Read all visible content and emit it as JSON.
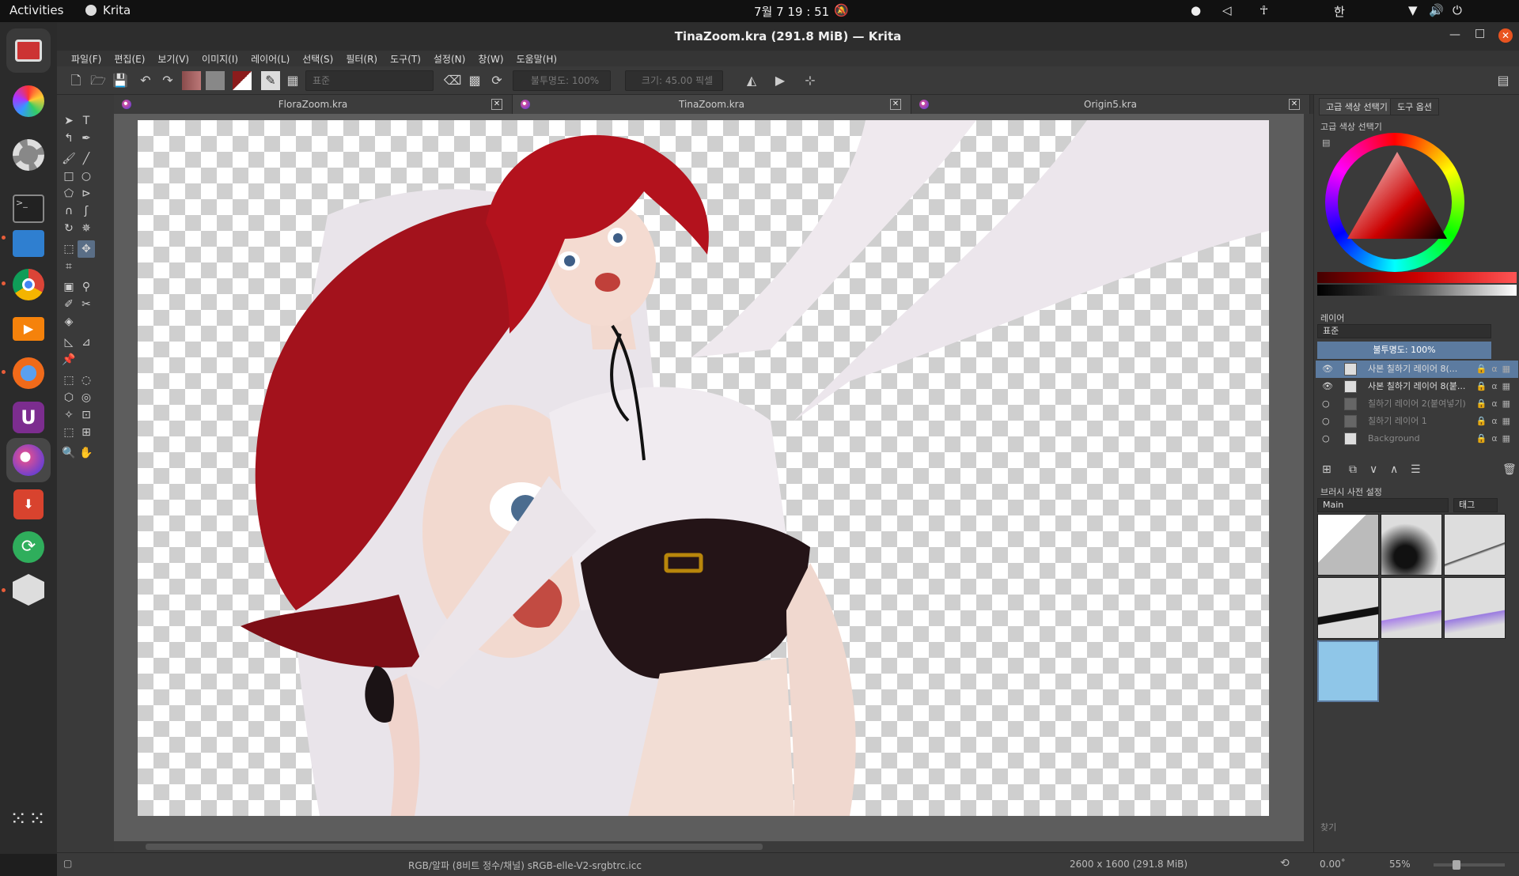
{
  "topbar": {
    "activities": "Activities",
    "app_name": "Krita",
    "clock": "7월 7  19 : 51",
    "input_method": "한"
  },
  "window": {
    "title": "TinaZoom.kra (291.8 MiB) — Krita"
  },
  "menu": [
    "파일(F)",
    "편집(E)",
    "보기(V)",
    "이미지(I)",
    "레이어(L)",
    "선택(S)",
    "필터(R)",
    "도구(T)",
    "설정(N)",
    "창(W)",
    "도움말(H)"
  ],
  "toolbar": {
    "blend_mode": "표준",
    "opacity": "불투명도: 100%",
    "size": "크기: 45.00 픽셀"
  },
  "tabs": [
    {
      "label": "FloraZoom.kra"
    },
    {
      "label": "TinaZoom.kra"
    },
    {
      "label": "Origin5.kra"
    }
  ],
  "docker": {
    "tab_color": "고급 색상 선택기",
    "tab_tool": "도구 옵션",
    "color_title": "고급 색상 선택기",
    "layers_title": "레이어",
    "layer_blend": "표준",
    "layer_opacity": "불투명도:  100%",
    "layers": [
      {
        "name": "사본 칠하기 레이어 8(..."
      },
      {
        "name": "사본 칠하기 레이어 8(붙..."
      },
      {
        "name": "칠하기 레이어 2(붙여넣기)"
      },
      {
        "name": "칠하기 레이어 1"
      },
      {
        "name": "Background"
      }
    ],
    "brush_title": "브러시 사전 설정",
    "brush_tag": "Main",
    "brush_tag_btn": "태그",
    "search": "찾기"
  },
  "status": {
    "colorspace": "RGB/알파 (8비트 정수/채널)  sRGB-elle-V2-srgbtrc.icc",
    "dimensions": "2600 x 1600 (291.8 MiB)",
    "rotation": "0.00˚",
    "zoom": "55%"
  },
  "colors": {
    "accent": "#5c7ba0",
    "hair": "#b3121d"
  }
}
